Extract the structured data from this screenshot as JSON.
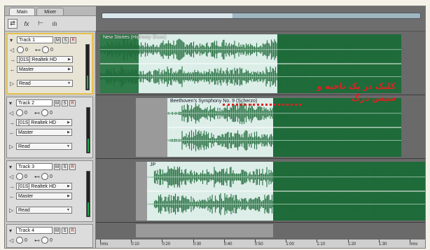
{
  "tabs": [
    {
      "label": "Main"
    },
    {
      "label": "Mixer"
    }
  ],
  "toolbar": {
    "tools": [
      "swap-icon",
      "fx-icon",
      "eq-icon",
      "meter-icon"
    ]
  },
  "tracks": [
    {
      "name": "Track 1",
      "m": "M",
      "s": "S",
      "r": "R",
      "vol": "0",
      "pan": "0",
      "input": "[01S] Realtek HD",
      "output": "Master",
      "automation": "Read",
      "clip_title": "New Stories (Highway Blues)"
    },
    {
      "name": "Track 2",
      "m": "M",
      "s": "S",
      "r": "R",
      "vol": "0",
      "pan": "0",
      "input": "[01S] Realtek HD",
      "output": "Master",
      "automation": "Read",
      "clip_title": "Beethoven's Symphony No. 9 (Scherzo)"
    },
    {
      "name": "Track 3",
      "m": "M",
      "s": "S",
      "r": "R",
      "vol": "0",
      "pan": "0",
      "input": "[01S] Realtek HD",
      "output": "Master",
      "automation": "Read",
      "clip_title": "JP"
    },
    {
      "name": "Track 4",
      "m": "M",
      "s": "S",
      "r": "R",
      "vol": "0",
      "pan": "0"
    }
  ],
  "ruler": {
    "labels": [
      "hms",
      "0:10",
      "0:20",
      "0:30",
      "0:40",
      "0:50",
      "1:00",
      "1:10",
      "1:20",
      "1:30",
      "hms"
    ]
  },
  "annotation": {
    "line1": "کلیک در یک ناحیه و",
    "line2": "سپس درگ"
  },
  "colors": {
    "wave": "#1f6b3a",
    "wave_light": "#7fc79a",
    "selection": "#e6f5f2",
    "annotation": "#e02020"
  }
}
